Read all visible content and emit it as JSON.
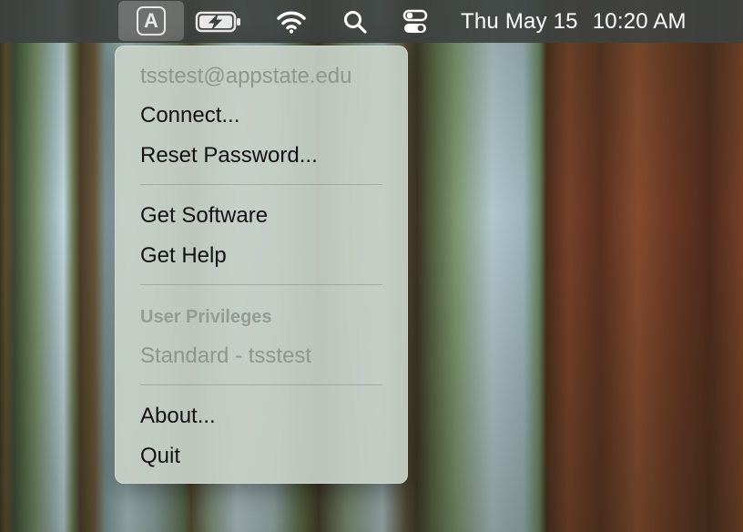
{
  "menubar": {
    "app_icon_letter": "A",
    "app_icon_name": "app-state-icon",
    "battery_icon_name": "battery-charging-icon",
    "wifi_icon_name": "wifi-icon",
    "search_icon_name": "search-icon",
    "control_center_icon_name": "control-center-icon",
    "date": "Thu May 15",
    "time": "10:20 AM"
  },
  "menu": {
    "account_email": "tsstest@appstate.edu",
    "items_group1": [
      "Connect...",
      "Reset Password..."
    ],
    "items_group2": [
      "Get Software",
      "Get Help"
    ],
    "privileges_header": "User Privileges",
    "privileges_value": "Standard - tsstest",
    "items_group3": [
      "About...",
      "Quit"
    ]
  }
}
